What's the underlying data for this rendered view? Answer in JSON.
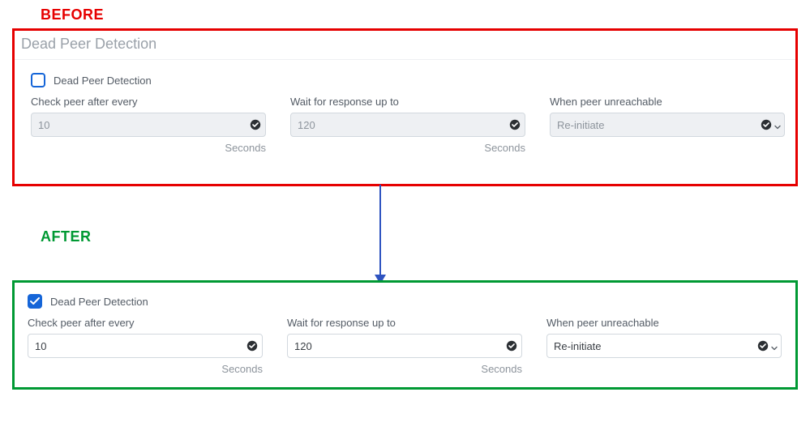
{
  "labels": {
    "before": "BEFORE",
    "after": "AFTER"
  },
  "before": {
    "section_title": "Dead Peer Detection",
    "checkbox_label": "Dead Peer Detection",
    "checked": false,
    "fields": {
      "check_peer": {
        "label": "Check peer after every",
        "value": "10",
        "unit": "Seconds"
      },
      "wait_resp": {
        "label": "Wait for response up to",
        "value": "120",
        "unit": "Seconds"
      },
      "when_unreachable": {
        "label": "When peer unreachable",
        "value": "Re-initiate"
      }
    }
  },
  "after": {
    "checkbox_label": "Dead Peer Detection",
    "checked": true,
    "fields": {
      "check_peer": {
        "label": "Check peer after every",
        "value": "10",
        "unit": "Seconds"
      },
      "wait_resp": {
        "label": "Wait for response up to",
        "value": "120",
        "unit": "Seconds"
      },
      "when_unreachable": {
        "label": "When peer unreachable",
        "value": "Re-initiate"
      }
    }
  }
}
